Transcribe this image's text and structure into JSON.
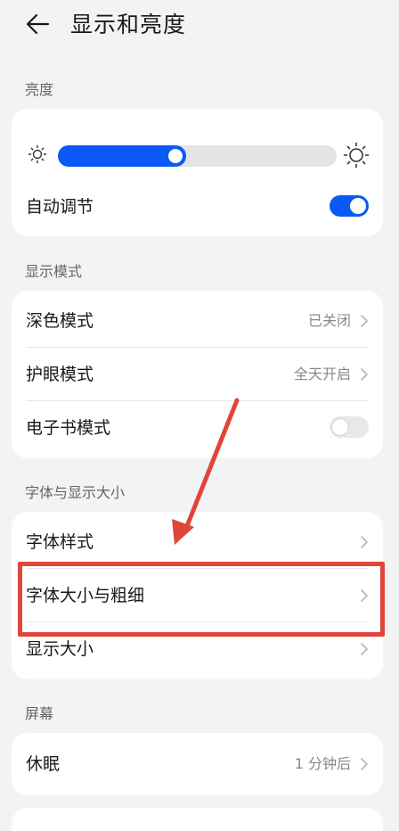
{
  "header": {
    "title": "显示和亮度",
    "back_icon": "arrow-left-icon"
  },
  "brightness": {
    "section_label": "亮度",
    "slider_level": 0.46,
    "auto_adjust_label": "自动调节",
    "auto_adjust_on": true
  },
  "display_mode": {
    "section_label": "显示模式",
    "items": [
      {
        "label": "深色模式",
        "value": "已关闭"
      },
      {
        "label": "护眼模式",
        "value": "全天开启"
      },
      {
        "label": "电子书模式",
        "toggle_on": false
      }
    ]
  },
  "font_display": {
    "section_label": "字体与显示大小",
    "items": [
      {
        "label": "字体样式"
      },
      {
        "label": "字体大小与粗细"
      },
      {
        "label": "显示大小"
      }
    ]
  },
  "screen": {
    "section_label": "屏幕",
    "items": [
      {
        "label": "休眠",
        "value": "1 分钟后"
      }
    ]
  },
  "colors": {
    "accent": "#0a59f7",
    "annotation": "#e0453a",
    "background": "#f1f3f5"
  }
}
